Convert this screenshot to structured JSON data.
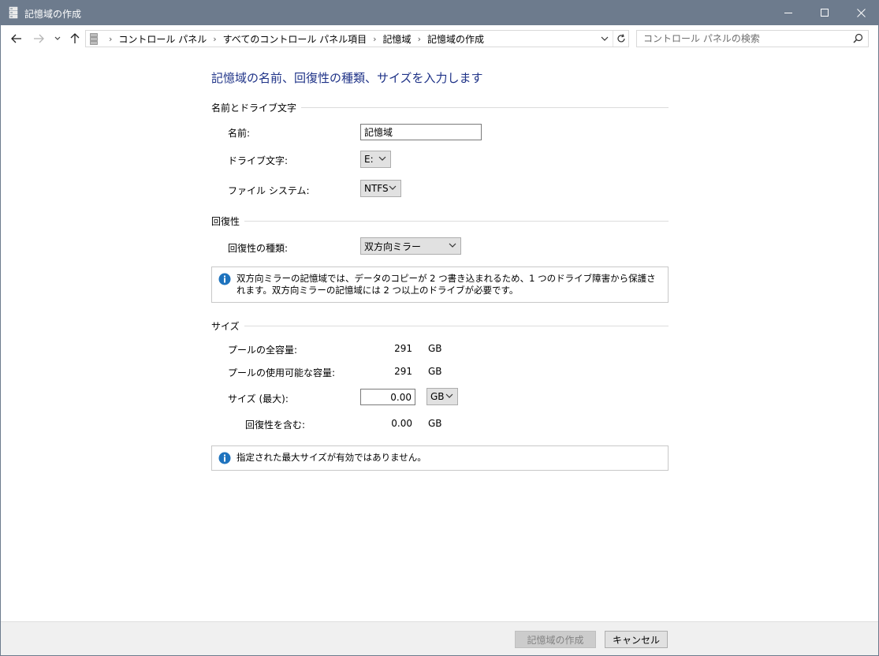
{
  "window": {
    "title": "記憶域の作成",
    "titlebar_color": "#6d7b8d"
  },
  "navbar": {
    "breadcrumbs": [
      "コントロール パネル",
      "すべてのコントロール パネル項目",
      "記憶域",
      "記憶域の作成"
    ],
    "search_placeholder": "コントロール パネルの検索"
  },
  "page": {
    "heading": "記憶域の名前、回復性の種類、サイズを入力します",
    "heading_color": "#1e3287"
  },
  "name_section": {
    "title": "名前とドライブ文字",
    "name_label": "名前:",
    "name_value": "記憶域",
    "drive_label": "ドライブ文字:",
    "drive_value": "E:",
    "fs_label": "ファイル システム:",
    "fs_value": "NTFS"
  },
  "resiliency_section": {
    "title": "回復性",
    "type_label": "回復性の種類:",
    "type_value": "双方向ミラー",
    "info_text": "双方向ミラーの記憶域では、データのコピーが 2 つ書き込まれるため、1 つのドライブ障害から保護されます。双方向ミラーの記憶域には 2 つ以上のドライブが必要です。"
  },
  "size_section": {
    "title": "サイズ",
    "total_label": "プールの全容量:",
    "total_value": "291",
    "total_unit": "GB",
    "available_label": "プールの使用可能な容量:",
    "available_value": "291",
    "available_unit": "GB",
    "max_label": "サイズ (最大):",
    "max_value": "0.00",
    "max_unit": "GB",
    "incl_label": "回復性を含む:",
    "incl_value": "0.00",
    "incl_unit": "GB",
    "warning_text": "指定された最大サイズが有効ではありません。"
  },
  "footer": {
    "create_label": "記憶域の作成",
    "cancel_label": "キャンセル"
  },
  "icons": {
    "info_color": "#1e73be"
  }
}
